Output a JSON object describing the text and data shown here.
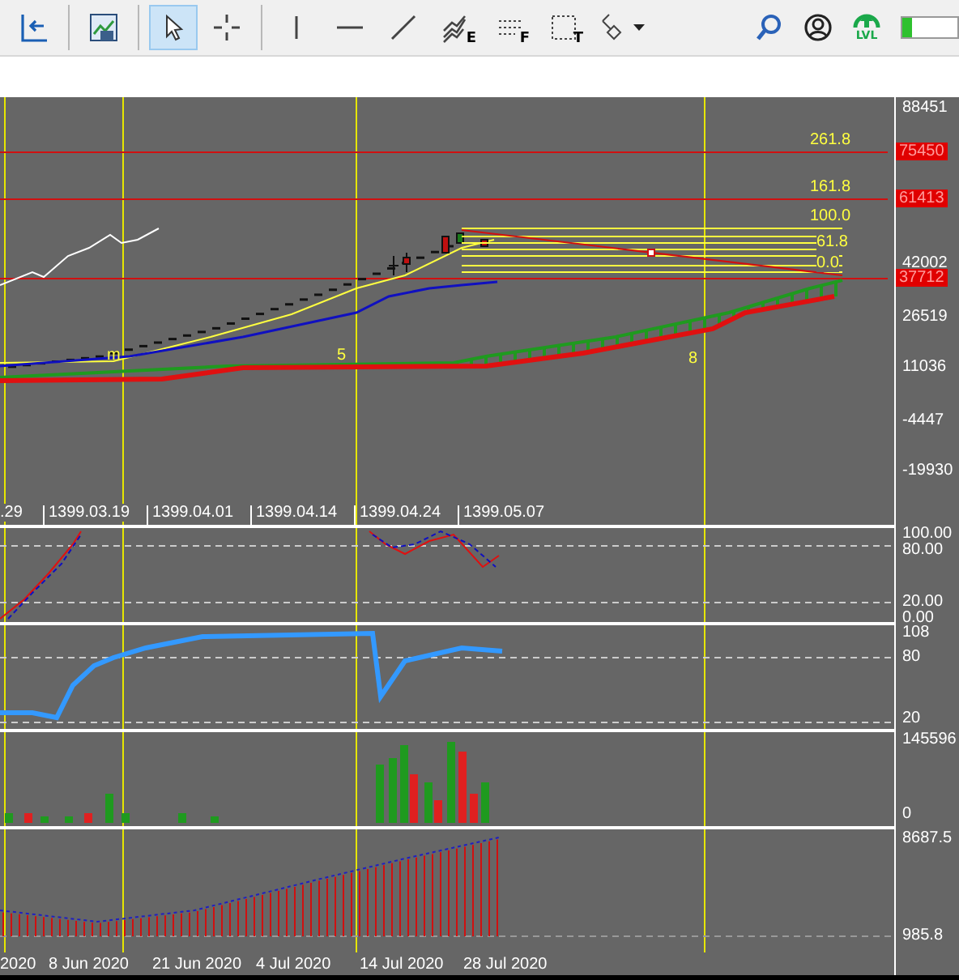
{
  "toolbar": {
    "groups": [
      [
        {
          "kind": "back",
          "selected": false
        }
      ],
      [
        {
          "kind": "template",
          "selected": false
        }
      ],
      [
        {
          "kind": "cursor",
          "selected": true
        },
        {
          "kind": "crosshair",
          "selected": false
        }
      ],
      [
        {
          "kind": "vline",
          "selected": false
        },
        {
          "kind": "hline",
          "selected": false
        },
        {
          "kind": "trend",
          "selected": false
        },
        {
          "kind": "fib",
          "letter": "E",
          "selected": false
        },
        {
          "kind": "grid",
          "letter": "F",
          "selected": false
        },
        {
          "kind": "text",
          "letter": "T",
          "selected": false
        },
        {
          "kind": "shapes",
          "selected": false
        }
      ]
    ],
    "badge": "LVL",
    "progress": {
      "level": 0.18
    }
  },
  "main_pane": {
    "axis": [
      "88451",
      "42002",
      "26519",
      "11036",
      "-4447",
      "-19930"
    ],
    "price_labels": [
      "75450",
      "61413",
      "37712"
    ],
    "fib_levels": [
      "261.8",
      "161.8",
      "100.0",
      "61.8",
      "0.0"
    ],
    "wave_labels": [
      "m",
      "5",
      "8"
    ],
    "date_labels": [
      ".29",
      "1399.03.19",
      "1399.04.01",
      "1399.04.14",
      "1399.04.24",
      "1399.05.07"
    ]
  },
  "panes": [
    {
      "axis": [
        "100.00",
        "80.00",
        "20.00",
        "0.00"
      ]
    },
    {
      "axis": [
        "108",
        "80",
        "20"
      ]
    },
    {
      "axis": [
        "145596",
        "0"
      ]
    },
    {
      "axis": [
        "8687.5",
        "985.8"
      ]
    }
  ],
  "time_axis": [
    "2020",
    "8 Jun 2020",
    "21 Jun 2020",
    "4 Jul 2020",
    "14 Jul 2020",
    "28 Jul 2020"
  ]
}
